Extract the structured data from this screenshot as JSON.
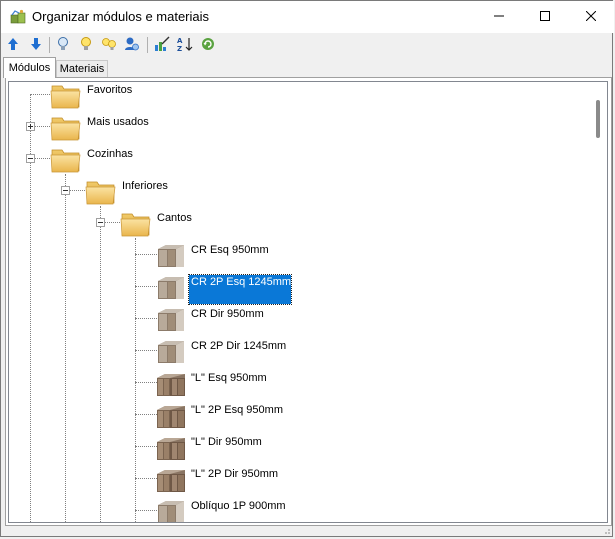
{
  "window": {
    "title": "Organizar módulos e materiais",
    "minimize_icon": "minimize-icon",
    "maximize_icon": "maximize-icon",
    "close_icon": "close-icon"
  },
  "toolbar": {
    "buttons": [
      {
        "icon": "arrow-up-icon"
      },
      {
        "icon": "arrow-down-icon"
      },
      {
        "icon": "lightbulb-off-icon"
      },
      {
        "icon": "lightbulb-on-icon"
      },
      {
        "icon": "lightbulbs-icon"
      },
      {
        "icon": "user-search-icon"
      },
      {
        "icon": "edit-chart-icon"
      },
      {
        "icon": "sort-az-icon"
      },
      {
        "icon": "refresh-icon"
      }
    ]
  },
  "tabs": [
    {
      "label": "Módulos",
      "active": true
    },
    {
      "label": "Materiais",
      "active": false
    }
  ],
  "tree": {
    "nodes": [
      {
        "label": "Favoritos"
      },
      {
        "label": "Mais usados"
      },
      {
        "label": "Cozinhas"
      },
      {
        "label": "Inferiores"
      },
      {
        "label": "Cantos"
      },
      {
        "label": "CR Esq 950mm"
      },
      {
        "label": "CR 2P Esq 1245mm",
        "selected": true
      },
      {
        "label": "CR Dir 950mm"
      },
      {
        "label": "CR 2P Dir 1245mm"
      },
      {
        "label": "\"L\" Esq 950mm"
      },
      {
        "label": "\"L\" 2P Esq 950mm"
      },
      {
        "label": "\"L\" Dir 950mm"
      },
      {
        "label": "\"L\" 2P Dir 950mm"
      },
      {
        "label": "Oblíquo 1P 900mm"
      }
    ]
  },
  "colors": {
    "selection": "#0a78d7",
    "folder": "#f5d27a"
  }
}
